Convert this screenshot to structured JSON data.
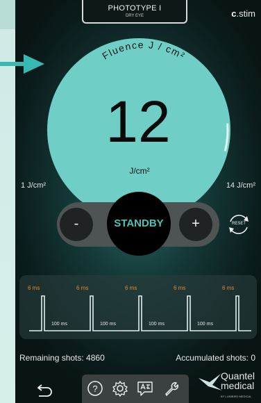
{
  "header": {
    "title": "PHOTOTYPE I",
    "subtitle": "DRY EYE"
  },
  "brand": {
    "prefix": "c",
    "name": "stim"
  },
  "gauge": {
    "arc_label": "Fluence J / cm²",
    "value": "12",
    "unit": "J/cm²",
    "min_label": "1 J/cm²",
    "max_label": "14 J/cm²",
    "min": 1,
    "max": 14,
    "current": 12
  },
  "controls": {
    "minus": "-",
    "plus": "+",
    "standby": "STANDBY",
    "reset": "RESET"
  },
  "pulses": {
    "on_labels": [
      "6 ms",
      "6 ms",
      "6 ms",
      "6 ms",
      "6 ms"
    ],
    "gap_labels": [
      "100 ms",
      "100 ms",
      "100 ms",
      "100 ms"
    ]
  },
  "stats": {
    "remaining": "Remaining shots: 4860",
    "accumulated": "Accumulated shots: 0"
  },
  "toolbar": {
    "icons": [
      "back-icon",
      "help-icon",
      "settings-icon",
      "language-icon",
      "wrench-icon"
    ]
  },
  "logo": {
    "line1": "Quantel",
    "line2": "medical",
    "sub": "BY LUMIBIRD MEDICAL"
  },
  "colors": {
    "accent": "#6fcfc6",
    "standby_text": "#4ec3b6",
    "pulse_label": "#e8872a",
    "background": "#0b1b1b"
  }
}
